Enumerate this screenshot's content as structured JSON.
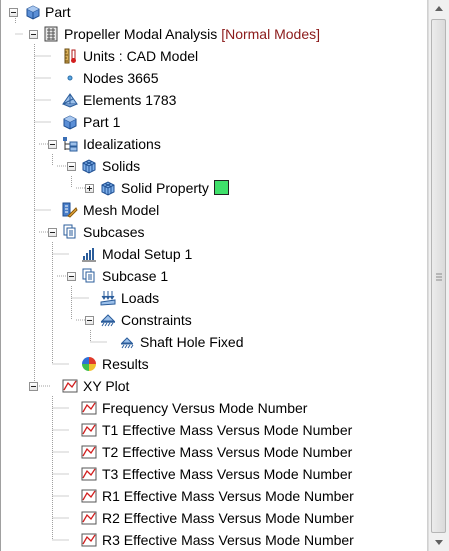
{
  "tree": {
    "root": "Part",
    "analysis": "Propeller Modal Analysis",
    "analysis_suffix": "[Normal Modes]",
    "units": "Units : CAD Model",
    "nodes": "Nodes 3665",
    "elements": "Elements 1783",
    "part1": "Part 1",
    "idealizations": "Idealizations",
    "solids": "Solids",
    "solid_property": "Solid Property",
    "mesh_model": "Mesh Model",
    "subcases": "Subcases",
    "modal_setup": "Modal Setup 1",
    "subcase1": "Subcase 1",
    "loads": "Loads",
    "constraints": "Constraints",
    "shaft_hole": "Shaft Hole Fixed",
    "results": "Results",
    "xy_plot": "XY Plot",
    "plots": [
      "Frequency Versus Mode Number",
      "T1 Effective Mass Versus Mode Number",
      "T2 Effective Mass Versus Mode Number",
      "T3 Effective Mass Versus Mode Number",
      "R1 Effective Mass Versus Mode Number",
      "R2 Effective Mass Versus Mode Number",
      "R3 Effective Mass Versus Mode Number"
    ]
  },
  "colors": {
    "solid_property_swatch": "#3fe06a",
    "suffix": "#8b1a1a"
  },
  "icons": [
    "collapse-toggle",
    "expand-toggle",
    "part-icon",
    "analysis-icon",
    "units-icon",
    "node-icon",
    "elements-icon",
    "idealizations-icon",
    "solids-icon",
    "mesh-model-icon",
    "subcases-icon",
    "modal-setup-icon",
    "loads-icon",
    "constraints-icon",
    "results-icon",
    "xy-plot-icon"
  ]
}
